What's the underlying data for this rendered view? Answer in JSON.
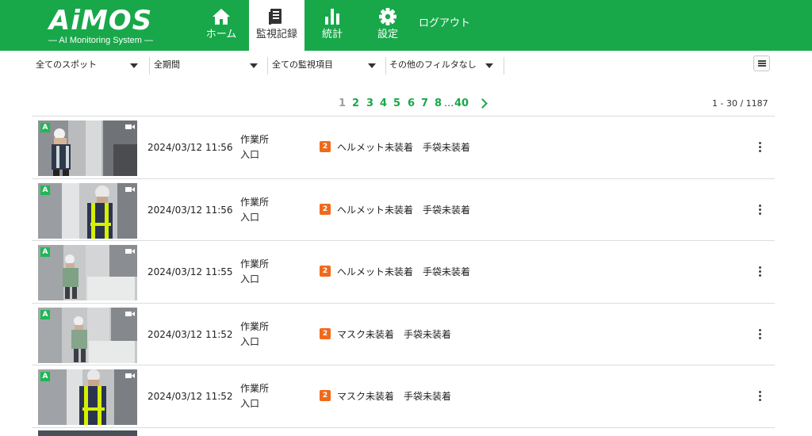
{
  "app": {
    "logo": "AiMOS",
    "logo_sub": "— AI Monitoring System —"
  },
  "nav": {
    "items": [
      {
        "label": "ホーム",
        "icon": "home-icon"
      },
      {
        "label": "監視記録",
        "icon": "record-icon",
        "active": true
      },
      {
        "label": "統計",
        "icon": "chart-icon"
      },
      {
        "label": "設定",
        "icon": "gear-icon"
      }
    ],
    "logout": "ログアウト"
  },
  "filters": {
    "spot": "全てのスポット",
    "period": "全期間",
    "item": "全ての監視項目",
    "other": "その他のフィルタなし"
  },
  "pagination": {
    "pages": [
      "1",
      "2",
      "3",
      "4",
      "5",
      "6",
      "7",
      "8"
    ],
    "current": "1",
    "dots": "...",
    "last": "40",
    "range": "1 - 30 / 1187"
  },
  "records": [
    {
      "badge": "A",
      "timestamp": "2024/03/12 11:56",
      "place": "作業所",
      "spot": "入口",
      "count": "2",
      "violations": [
        "ヘルメット未装着",
        "手袋未装着"
      ]
    },
    {
      "badge": "A",
      "timestamp": "2024/03/12 11:56",
      "place": "作業所",
      "spot": "入口",
      "count": "2",
      "violations": [
        "ヘルメット未装着",
        "手袋未装着"
      ]
    },
    {
      "badge": "A",
      "timestamp": "2024/03/12 11:55",
      "place": "作業所",
      "spot": "入口",
      "count": "2",
      "violations": [
        "ヘルメット未装着",
        "手袋未装着"
      ]
    },
    {
      "badge": "A",
      "timestamp": "2024/03/12 11:52",
      "place": "作業所",
      "spot": "入口",
      "count": "2",
      "violations": [
        "マスク未装着",
        "手袋未装着"
      ]
    },
    {
      "badge": "A",
      "timestamp": "2024/03/12 11:52",
      "place": "作業所",
      "spot": "入口",
      "count": "2",
      "violations": [
        "マスク未装着",
        "手袋未装着"
      ]
    }
  ],
  "colors": {
    "brand": "#18a84a",
    "count_badge": "#f06a1c",
    "camera_badge": "#1db954"
  }
}
